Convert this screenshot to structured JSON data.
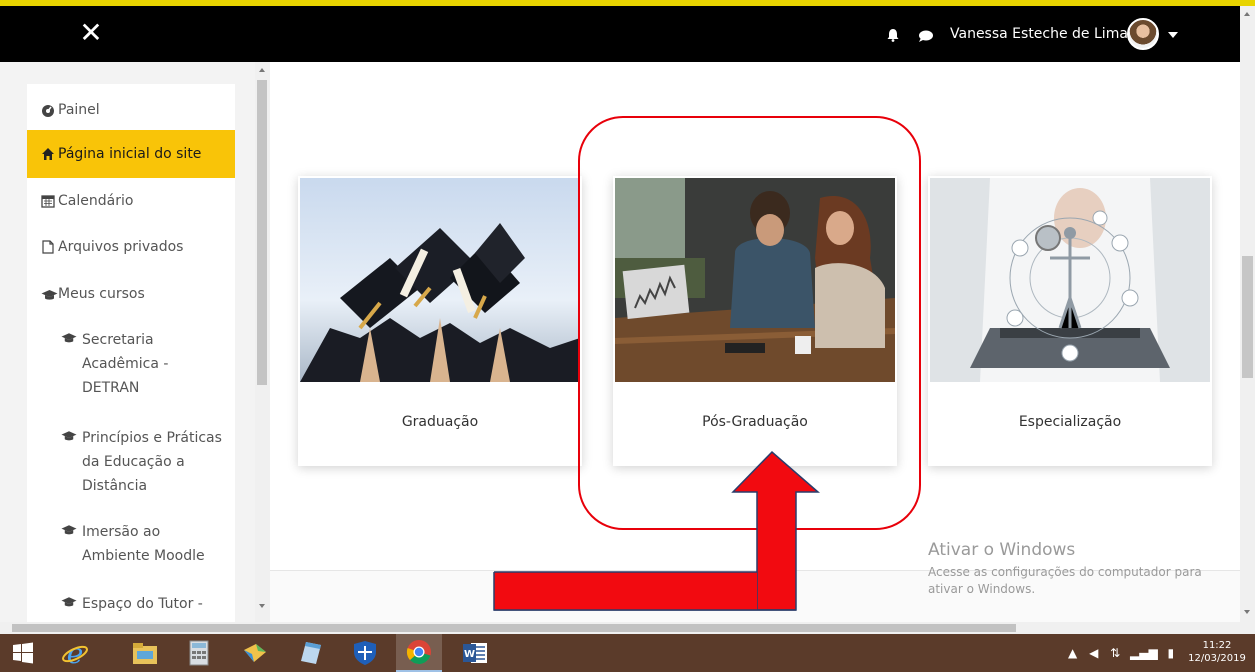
{
  "header": {
    "close_glyph": "✕",
    "user_name": "Vanessa Esteche de Lima"
  },
  "sidebar": {
    "items": [
      {
        "label": "Painel",
        "icon": "dashboard-icon"
      },
      {
        "label": "Página inicial do site",
        "icon": "home-icon",
        "active": true
      },
      {
        "label": "Calendário",
        "icon": "calendar-icon"
      },
      {
        "label": "Arquivos privados",
        "icon": "file-icon"
      },
      {
        "label": "Meus cursos",
        "icon": "graduation-cap-icon"
      }
    ],
    "courses": [
      {
        "label": "Secretaria\nAcadêmica -\nDETRAN"
      },
      {
        "label": "Princípios e Práticas\nda Educação a\nDistância"
      },
      {
        "label": "Imersão ao\nAmbiente Moodle"
      },
      {
        "label": "Espaço do Tutor -"
      }
    ]
  },
  "cards": [
    {
      "caption": "Graduação",
      "image": "graduation-caps-photo"
    },
    {
      "caption": "Pós-Graduação",
      "image": "business-meeting-photo"
    },
    {
      "caption": "Especialização",
      "image": "medical-tech-photo"
    }
  ],
  "watermark": {
    "title": "Ativar o Windows",
    "line1": "Acesse as configurações do computador para",
    "line2": "ativar o Windows."
  },
  "taskbar": {
    "apps": [
      "windows-start-icon",
      "internet-explorer-icon",
      "file-explorer-icon",
      "calculator-icon",
      "paint-icon",
      "notes-icon",
      "security-shield-icon",
      "chrome-icon",
      "word-icon"
    ],
    "time": "11:22",
    "date": "12/03/2019"
  },
  "colors": {
    "accent": "#f9c408",
    "annotation": "#e8000a",
    "topbar": "#000000"
  }
}
